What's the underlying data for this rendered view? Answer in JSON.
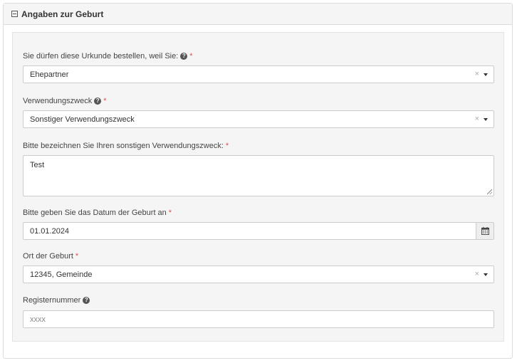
{
  "panel": {
    "title": "Angaben zur Geburt"
  },
  "fields": {
    "reason": {
      "label": "Sie dürfen diese Urkunde bestellen, weil Sie:",
      "required_mark": "*",
      "value": "Ehepartner",
      "clear_glyph": "×"
    },
    "purpose": {
      "label": "Verwendungszweck",
      "required_mark": "*",
      "value": "Sonstiger Verwendungszweck",
      "clear_glyph": "×"
    },
    "other_purpose": {
      "label": "Bitte bezeichnen Sie Ihren sonstigen Verwendungszweck:",
      "required_mark": "*",
      "value": "Test"
    },
    "birth_date": {
      "label": "Bitte geben Sie das Datum der Geburt an",
      "required_mark": "*",
      "value": "01.01.2024"
    },
    "birth_place": {
      "label": "Ort der Geburt",
      "required_mark": "*",
      "value": "12345, Gemeinde",
      "clear_glyph": "×"
    },
    "register_number": {
      "label": "Registernummer",
      "placeholder": "xxxx"
    }
  },
  "icons": {
    "help": "?",
    "help_icon": "question-circle-icon",
    "collapse_icon": "minus-square-icon",
    "calendar_icon": "calendar-icon"
  },
  "colors": {
    "required": "#d9534f",
    "panel_header_bg": "#f5f5f5",
    "body_bg": "#f5f5f5"
  }
}
